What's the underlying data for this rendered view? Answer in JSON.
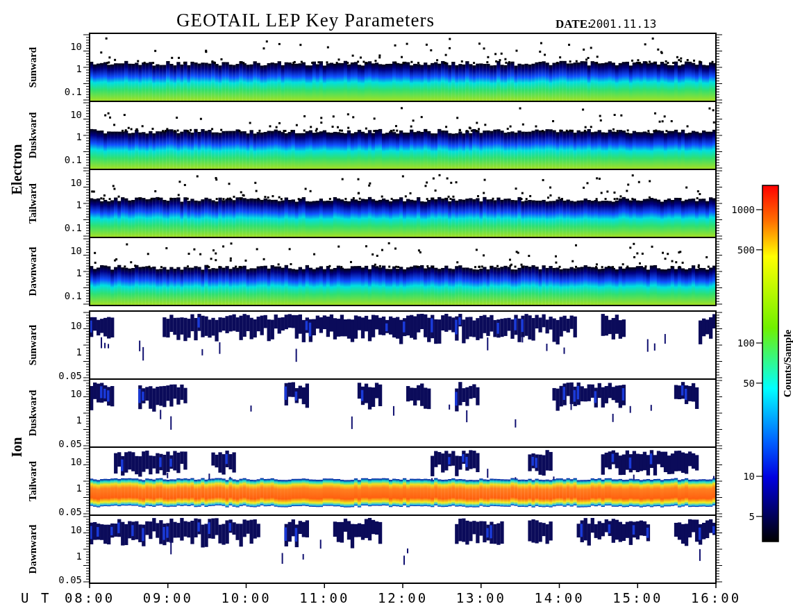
{
  "title": "GEOTAIL LEP Key Parameters",
  "date": {
    "label": "DATE:",
    "value": "2001.11.13"
  },
  "groups": [
    {
      "label": "Electron",
      "panels": [
        {
          "label": "Sunward",
          "kind": "electron-band",
          "yticks": [
            "10",
            "1",
            "0.1"
          ]
        },
        {
          "label": "Duskward",
          "kind": "electron-band",
          "yticks": [
            "10",
            "1",
            "0.1"
          ]
        },
        {
          "label": "Tailward",
          "kind": "electron-band",
          "yticks": [
            "10",
            "1",
            "0.1"
          ]
        },
        {
          "label": "Dawnward",
          "kind": "electron-band",
          "yticks": [
            "10",
            "1",
            "0.1"
          ]
        }
      ]
    },
    {
      "label": "Ion",
      "panels": [
        {
          "label": "Sunward",
          "kind": "ion-patchy",
          "yticks": [
            "10",
            "1",
            "0.05"
          ]
        },
        {
          "label": "Duskward",
          "kind": "ion-patchy",
          "yticks": [
            "10",
            "1",
            "0.05"
          ]
        },
        {
          "label": "Tailward",
          "kind": "ion-band",
          "yticks": [
            "10",
            "1",
            "0.05"
          ]
        },
        {
          "label": "Dawnward",
          "kind": "ion-patchy",
          "yticks": [
            "10",
            "1",
            "0.05"
          ]
        }
      ]
    }
  ],
  "time_axis": {
    "label": "U T",
    "ticks": [
      "08:00",
      "09:00",
      "10:00",
      "11:00",
      "12:00",
      "13:00",
      "14:00",
      "15:00",
      "16:00"
    ]
  },
  "colorbar": {
    "label": "Counts/Sample",
    "ticks": [
      "1000",
      "500",
      "100",
      "50",
      "10",
      "5"
    ]
  }
}
